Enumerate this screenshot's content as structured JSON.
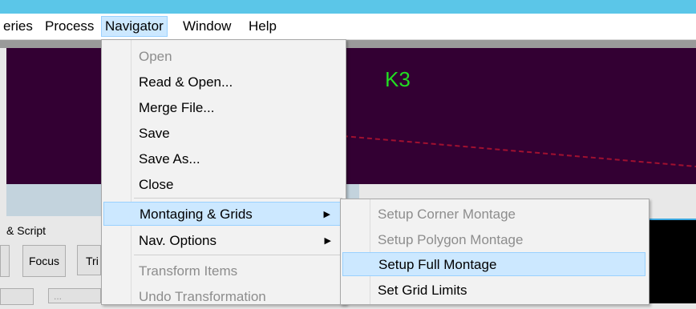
{
  "menubar": {
    "items": [
      {
        "label": "eries"
      },
      {
        "label": "Process"
      },
      {
        "label": "Navigator"
      },
      {
        "label": "Window"
      },
      {
        "label": "Help"
      }
    ]
  },
  "viewport": {
    "label": "K3",
    "label_color": "#22dd22",
    "background": "#330033"
  },
  "panel": {
    "label": "& Script",
    "focus_button": "Focus",
    "tri_button": "Tri",
    "small_button": "..."
  },
  "navigator_menu": {
    "items": [
      {
        "label": "Open",
        "enabled": false
      },
      {
        "label": "Read & Open...",
        "enabled": true
      },
      {
        "label": "Merge File...",
        "enabled": true
      },
      {
        "label": "Save",
        "enabled": true
      },
      {
        "label": "Save As...",
        "enabled": true
      },
      {
        "label": "Close",
        "enabled": true
      },
      {
        "label": "Montaging & Grids",
        "enabled": true,
        "submenu": true,
        "highlighted": true
      },
      {
        "label": "Nav. Options",
        "enabled": true,
        "submenu": true
      },
      {
        "label": "Transform Items",
        "enabled": false
      },
      {
        "label": "Undo Transformation",
        "enabled": false
      }
    ]
  },
  "montage_submenu": {
    "items": [
      {
        "label": "Setup Corner Montage",
        "enabled": false
      },
      {
        "label": "Setup Polygon Montage",
        "enabled": false
      },
      {
        "label": "Setup Full Montage",
        "enabled": true,
        "highlighted": true
      },
      {
        "label": "Set Grid Limits",
        "enabled": true
      }
    ]
  }
}
